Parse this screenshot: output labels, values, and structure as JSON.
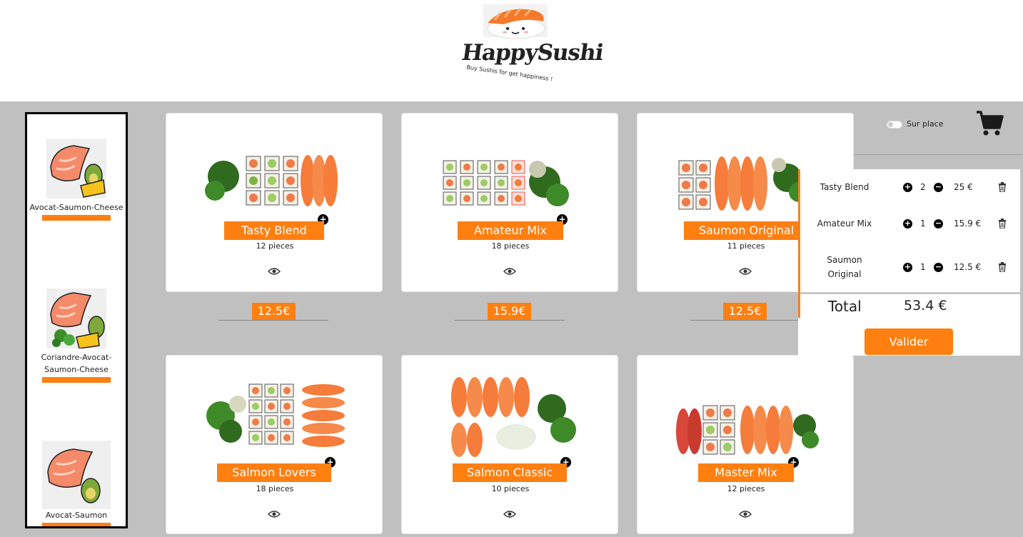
{
  "brand": {
    "name": "HappySushi",
    "tagline": "Buy Sushis for get happiness !"
  },
  "sidebar": {
    "items": [
      {
        "label": "Avocat-Saumon-Cheese",
        "icon": "salmon-avocado-cheese-icon"
      },
      {
        "label": "Coriandre-Avocat-Saumon-Cheese",
        "icon": "salmon-coriander-avocado-cheese-icon"
      },
      {
        "label": "Avocat-Saumon",
        "icon": "salmon-avocado-icon"
      }
    ]
  },
  "menu": {
    "items": [
      {
        "name": "Tasty Blend",
        "pieces": "12 pieces",
        "price": "12.5€"
      },
      {
        "name": "Amateur Mix",
        "pieces": "18 pieces",
        "price": "15.9€"
      },
      {
        "name": "Saumon Original",
        "pieces": "11 pieces",
        "price": "12.5€"
      },
      {
        "name": "Salmon Lovers",
        "pieces": "18 pieces"
      },
      {
        "name": "Salmon Classic",
        "pieces": "10 pieces"
      },
      {
        "name": "Master Mix",
        "pieces": "12 pieces"
      }
    ]
  },
  "cart": {
    "toggle_label": "Sur place",
    "items": [
      {
        "name": "Tasty Blend",
        "qty": "2",
        "price": "25 €"
      },
      {
        "name": "Amateur Mix",
        "qty": "1",
        "price": "15.9 €"
      },
      {
        "name": "Saumon Original",
        "qty": "1",
        "price": "12.5 €"
      }
    ],
    "total_label": "Total",
    "total_value": "53.4 €",
    "validate_label": "Valider"
  },
  "colors": {
    "accent": "#ff7f11",
    "background": "#c0c0c0"
  }
}
